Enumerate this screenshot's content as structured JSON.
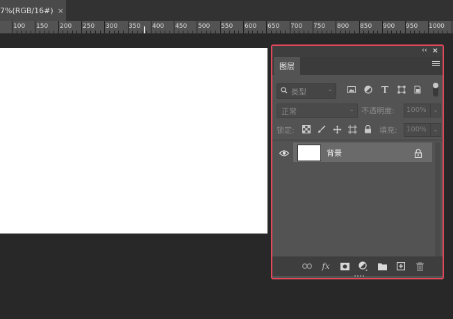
{
  "document_tab": {
    "title": "7%(RGB/16#)",
    "close_glyph": "×"
  },
  "ruler": {
    "labels": [
      "100",
      "150",
      "200",
      "250",
      "300",
      "350",
      "400",
      "450",
      "500",
      "550",
      "600",
      "650",
      "700",
      "750",
      "800",
      "850",
      "900",
      "950",
      "1000"
    ]
  },
  "layers_panel": {
    "collapse_glyph": "‹‹",
    "close_glyph": "×",
    "tab_label": "图层",
    "menu_icon": "hamburger-menu-icon",
    "filter": {
      "icon": "search-icon",
      "selected": "类型",
      "type_icons": [
        "image-filter-icon",
        "adjustment-filter-icon",
        "type-filter-icon",
        "shape-filter-icon",
        "smart-object-filter-icon"
      ]
    },
    "blend_mode": "正常",
    "opacity_label": "不透明度:",
    "opacity_value": "100%",
    "lock_label": "锁定:",
    "lock_icons": [
      "lock-transparent-pixels-icon",
      "lock-image-pixels-icon",
      "lock-position-icon",
      "lock-artboard-icon",
      "lock-all-icon"
    ],
    "fill_label": "填充:",
    "fill_value": "100%",
    "layers": [
      {
        "name": "背景",
        "visible": true,
        "locked": true
      }
    ],
    "footer_icons": [
      "link-layers-icon",
      "fx-icon",
      "add-mask-icon",
      "adjustment-layer-icon",
      "new-group-icon",
      "new-layer-icon",
      "delete-layer-icon"
    ],
    "fx_label": "fx"
  },
  "colors": {
    "workspace": "#282828",
    "panel": "#535353",
    "highlight_border": "#e1495b",
    "selected_layer": "#6a6a6a"
  }
}
